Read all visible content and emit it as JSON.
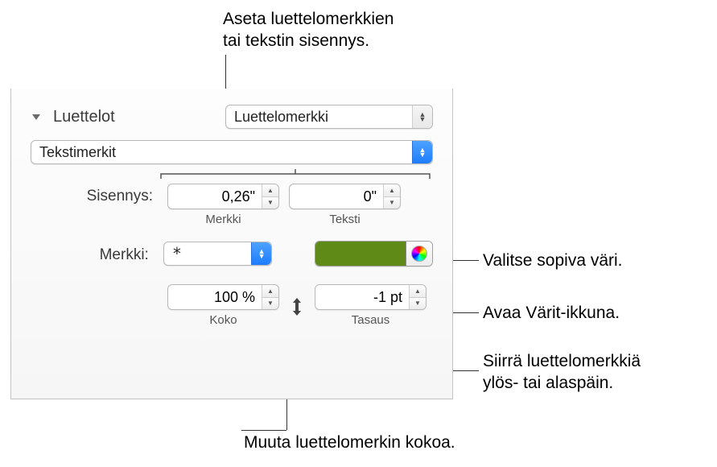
{
  "annotations": {
    "top": "Aseta luettelomerkkien\ntai tekstin sisennys.",
    "right1": "Valitse sopiva väri.",
    "right2": "Avaa Värit-ikkuna.",
    "right3": "Siirrä luettelomerkkiä\nylös- tai alaspäin.",
    "bottom": "Muuta luettelomerkin kokoa."
  },
  "panel": {
    "section_title": "Luettelot",
    "type_popup": "Luettelomerkki",
    "style_popup": "Tekstimerkit",
    "indent_label": "Sisennys:",
    "indent_bullet_value": "0,26\"",
    "indent_bullet_sublabel": "Merkki",
    "indent_text_value": "0\"",
    "indent_text_sublabel": "Teksti",
    "char_label": "Merkki:",
    "char_value": "*",
    "color_value": "#5f8a18",
    "size_value": "100 %",
    "size_sublabel": "Koko",
    "align_value": "-1 pt",
    "align_sublabel": "Tasaus"
  }
}
